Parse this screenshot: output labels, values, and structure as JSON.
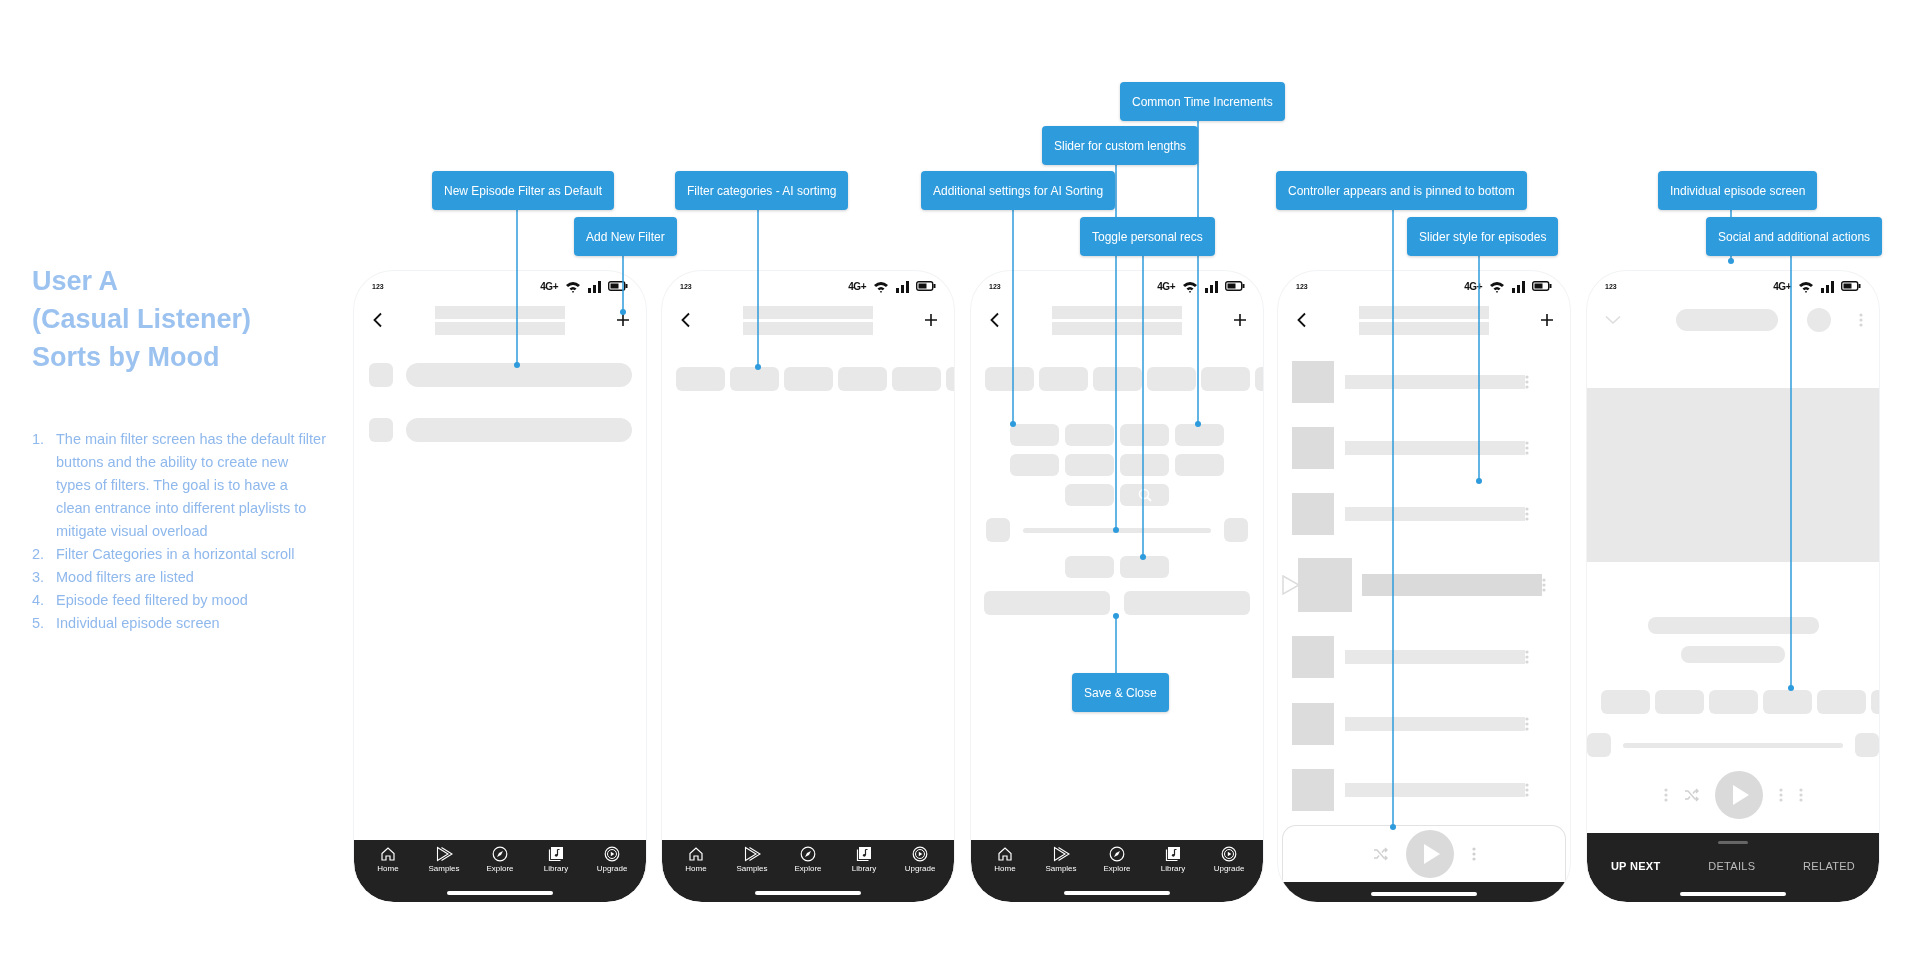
{
  "intro": {
    "title_lines": [
      "User A",
      "(Casual Listener)",
      "Sorts by Mood"
    ],
    "steps": [
      {
        "number": "1.",
        "text": "The main filter screen has the default filter buttons and the ability to create new types of filters.  The goal is to have a clean entrance into different playlists to mitigate visual overload"
      },
      {
        "number": "2.",
        "text": "Filter Categories in a horizontal scroll"
      },
      {
        "number": "3.",
        "text": "Mood filters are listed"
      },
      {
        "number": "4.",
        "text": "Episode feed filtered by mood"
      },
      {
        "number": "5.",
        "text": "Individual episode screen"
      }
    ]
  },
  "phones": [
    {
      "kind": "filters",
      "status": {
        "time": "123",
        "network": "4G+"
      },
      "nav": [
        {
          "label": "Home"
        },
        {
          "label": "Samples"
        },
        {
          "label": "Explore"
        },
        {
          "label": "Library"
        },
        {
          "label": "Upgrade"
        }
      ]
    },
    {
      "kind": "categories",
      "status": {
        "time": "123",
        "network": "4G+"
      },
      "nav": [
        {
          "label": "Home"
        },
        {
          "label": "Samples"
        },
        {
          "label": "Explore"
        },
        {
          "label": "Library"
        },
        {
          "label": "Upgrade"
        }
      ]
    },
    {
      "kind": "settings",
      "status": {
        "time": "123",
        "network": "4G+"
      },
      "nav": [
        {
          "label": "Home"
        },
        {
          "label": "Samples"
        },
        {
          "label": "Explore"
        },
        {
          "label": "Library"
        },
        {
          "label": "Upgrade"
        }
      ]
    },
    {
      "kind": "feed",
      "status": {
        "time": "123",
        "network": "4G+"
      }
    },
    {
      "kind": "episode",
      "status": {
        "time": "123",
        "network": "4G+"
      },
      "tabs": [
        {
          "label": "UP NEXT",
          "selected": true
        },
        {
          "label": "DETAILS",
          "selected": false
        },
        {
          "label": "RELATED",
          "selected": false
        }
      ]
    }
  ],
  "callouts": [
    {
      "text": "New Episode Filter as Default"
    },
    {
      "text": "Add New Filter"
    },
    {
      "text": "Filter categories - AI sortimg"
    },
    {
      "text": "Additional settings for AI Sorting"
    },
    {
      "text": "Slider for custom lengths"
    },
    {
      "text": "Common Time Increments"
    },
    {
      "text": "Toggle personal recs"
    },
    {
      "text": "Save & Close"
    },
    {
      "text": "Controller appears and is pinned to bottom"
    },
    {
      "text": "Slider style for episodes"
    },
    {
      "text": "Individual episode screen"
    },
    {
      "text": "Social and additional actions"
    }
  ]
}
